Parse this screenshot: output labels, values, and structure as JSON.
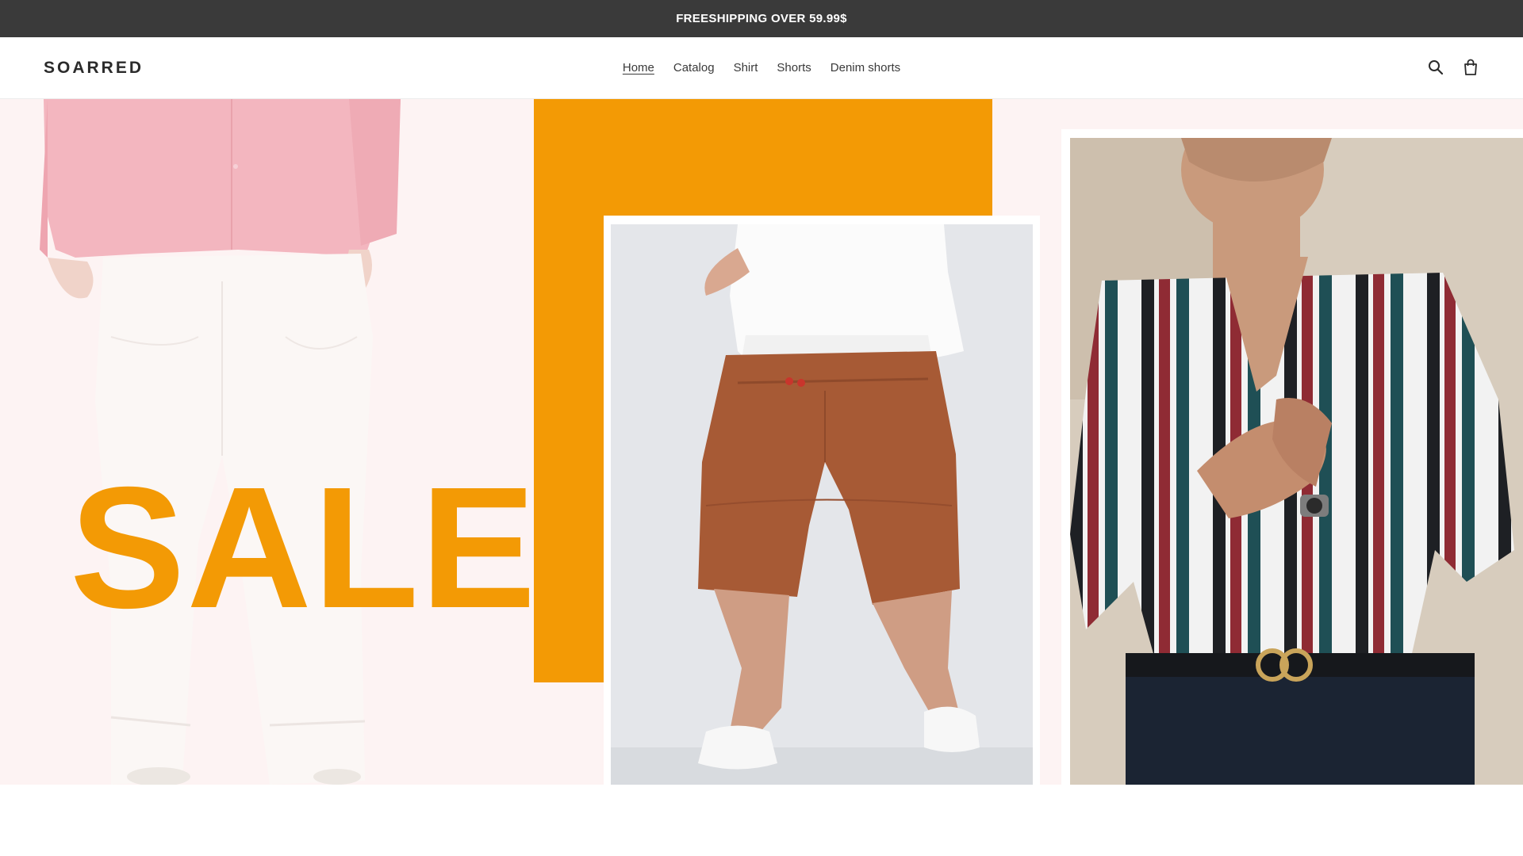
{
  "announcement": {
    "text": "FREESHIPPING OVER 59.99$"
  },
  "header": {
    "logo": "SOARRED",
    "nav": [
      {
        "label": "Home",
        "active": true
      },
      {
        "label": "Catalog",
        "active": false
      },
      {
        "label": "Shirt",
        "active": false
      },
      {
        "label": "Shorts",
        "active": false
      },
      {
        "label": "Denim shorts",
        "active": false
      }
    ],
    "icons": [
      "search-icon",
      "cart-icon"
    ]
  },
  "hero": {
    "headline": "SALE",
    "colors": {
      "accent": "#f39a05",
      "background": "#fdf3f3",
      "announcement_bg": "#3a3a3a"
    }
  }
}
